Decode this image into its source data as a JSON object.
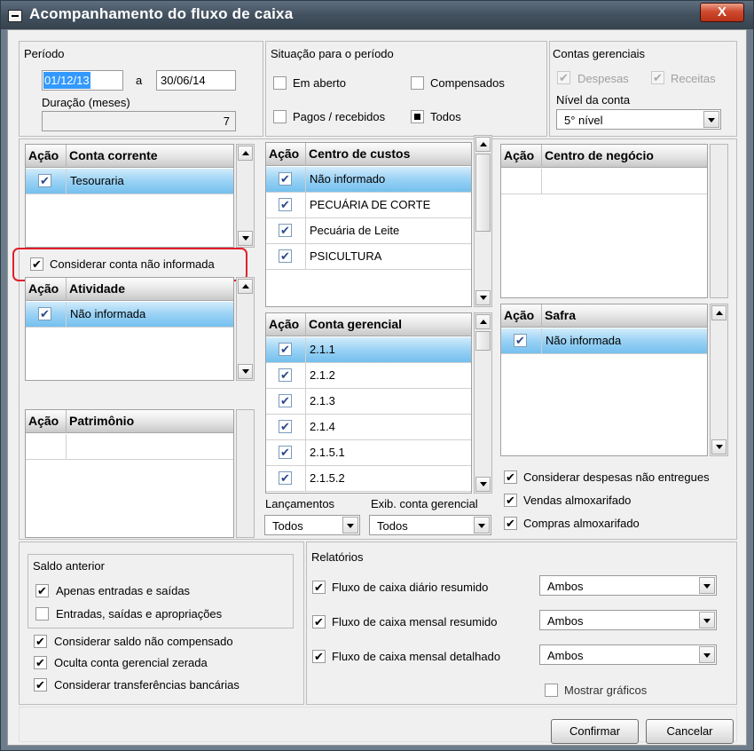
{
  "window": {
    "title": "Acompanhamento do fluxo de caixa",
    "close": "X"
  },
  "periodo": {
    "label": "Período",
    "start": "01/12/13",
    "sep": "a",
    "end": "30/06/14",
    "duracao_label": "Duração (meses)",
    "duracao_value": "7"
  },
  "situacao": {
    "label": "Situação para o período",
    "em_aberto": "Em aberto",
    "compensados": "Compensados",
    "pagos": "Pagos / recebidos",
    "todos": "Todos"
  },
  "contas_ger": {
    "label": "Contas gerenciais",
    "despesas": "Despesas",
    "receitas": "Receitas",
    "nivel_label": "Nível da conta",
    "nivel_value": "5° nível"
  },
  "conta_corrente": {
    "acao": "Ação",
    "header": "Conta corrente",
    "rows": [
      "Tesouraria"
    ]
  },
  "considerar_conta": "Considerar conta não informada",
  "atividade": {
    "acao": "Ação",
    "header": "Atividade",
    "rows": [
      "Não informada"
    ]
  },
  "patrimonio": {
    "acao": "Ação",
    "header": "Patrimônio"
  },
  "centro_custos": {
    "acao": "Ação",
    "header": "Centro de custos",
    "rows": [
      "Não informado",
      "PECUÁRIA DE CORTE",
      "Pecuária de Leite",
      "PSICULTURA"
    ]
  },
  "conta_gerencial": {
    "acao": "Ação",
    "header": "Conta gerencial",
    "rows": [
      "2.1.1",
      "2.1.2",
      "2.1.3",
      "2.1.4",
      "2.1.5.1",
      "2.1.5.2"
    ]
  },
  "lancamentos": {
    "label": "Lançamentos",
    "value": "Todos"
  },
  "exib": {
    "label": "Exib. conta gerencial",
    "value": "Todos"
  },
  "centro_negocio": {
    "acao": "Ação",
    "header": "Centro de negócio"
  },
  "safra": {
    "acao": "Ação",
    "header": "Safra",
    "rows": [
      "Não informada"
    ]
  },
  "opcoes_dir": {
    "despesas_nao_entregues": "Considerar despesas não entregues",
    "vendas_almox": "Vendas almoxarifado",
    "compras_almox": "Compras almoxarifado"
  },
  "saldo_anterior": {
    "label": "Saldo anterior",
    "apenas": "Apenas entradas e saídas",
    "entradas": "Entradas, saídas e apropriações"
  },
  "opcoes_esq": {
    "saldo_nao_comp": "Considerar saldo não compensado",
    "oculta": "Oculta conta gerencial zerada",
    "transferencias": "Considerar transferências bancárias"
  },
  "relatorios": {
    "label": "Relatórios",
    "diario": "Fluxo de caixa diário resumido",
    "mensal": "Fluxo de caixa mensal resumido",
    "mensal_det": "Fluxo de caixa mensal detalhado",
    "ambos": "Ambos",
    "mostrar": "Mostrar gráficos"
  },
  "buttons": {
    "confirmar": "Confirmar",
    "cancelar": "Cancelar"
  },
  "check_glyph": "✔",
  "colors": {
    "titlebar": "#43515f",
    "selection": "#3399ff",
    "highlight_row": "#9ad2f5",
    "annotation": "#e0202a"
  }
}
